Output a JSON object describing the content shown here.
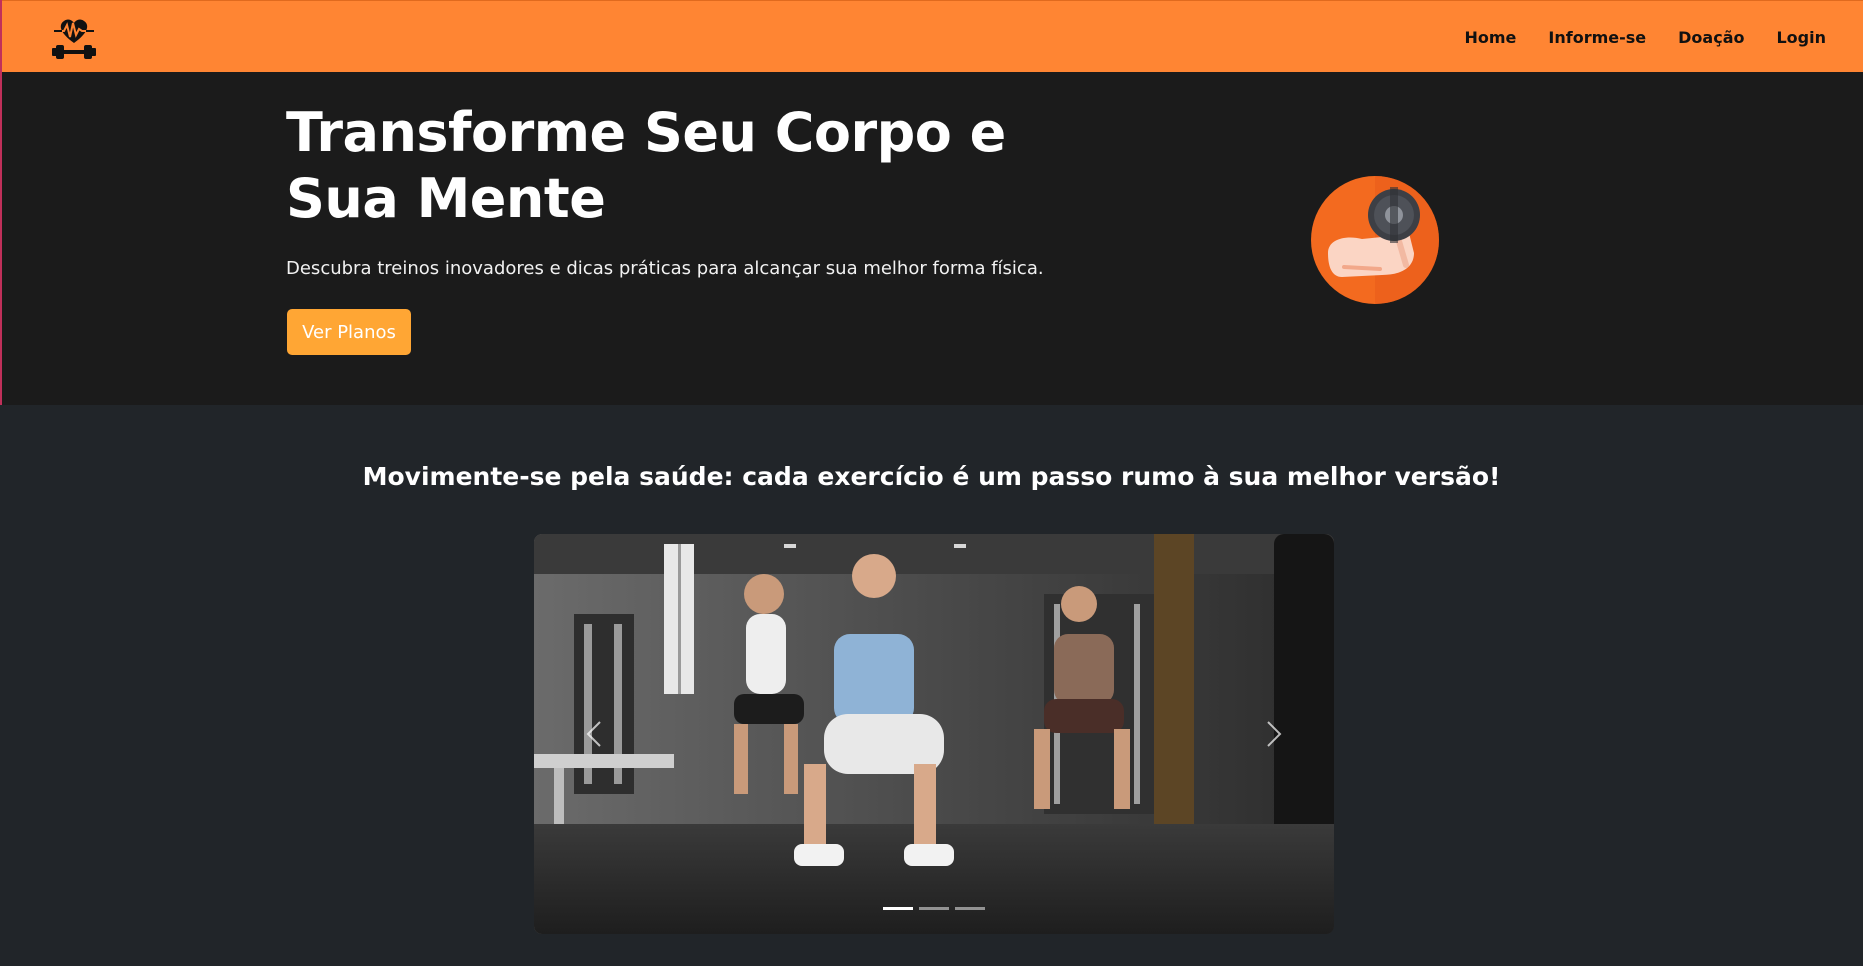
{
  "navbar": {
    "logo_icon": "heart-dumbbell-icon",
    "bg_color": "#ff8533",
    "links": [
      {
        "label": "Home"
      },
      {
        "label": "Informe-se"
      },
      {
        "label": "Doação"
      },
      {
        "label": "Login"
      }
    ]
  },
  "hero": {
    "title": "Transforme Seu Corpo e Sua Mente",
    "subtitle": "Descubra treinos inovadores e dicas práticas para alcançar sua melhor forma física.",
    "button_label": "Ver Planos",
    "button_color": "#ffa634",
    "icon": "flexed-arm-dumbbell-icon"
  },
  "section": {
    "title": "Movimente-se pela saúde: cada exercício é um passo rumo à sua melhor versão!"
  },
  "carousel": {
    "image_description_icon": "gym-squat-photo",
    "prev_icon": "chevron-left-icon",
    "next_icon": "chevron-right-icon",
    "slide_count": 3,
    "active_slide": 1
  }
}
